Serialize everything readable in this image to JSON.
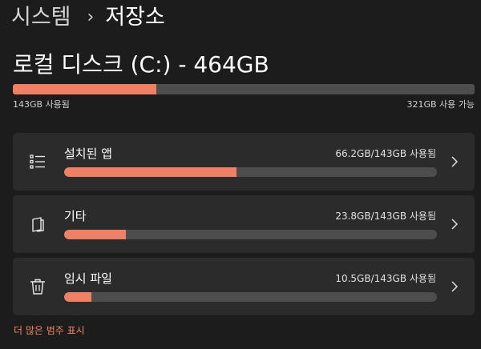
{
  "breadcrumb": {
    "parent": "시스템",
    "separator": "›",
    "current": "저장소"
  },
  "drive": {
    "title": "로컬 디스크 (C:) - 464GB",
    "used_label": "143GB 사용됨",
    "free_label": "321GB 사용 가능",
    "used_fraction": 0.31
  },
  "categories": [
    {
      "label": "설치된 앱",
      "usage": "66.2GB/143GB 사용됨",
      "fraction": 0.463,
      "icon": "apps-list-icon"
    },
    {
      "label": "기타",
      "usage": "23.8GB/143GB 사용됨",
      "fraction": 0.166,
      "icon": "other-document-icon"
    },
    {
      "label": "임시 파일",
      "usage": "10.5GB/143GB 사용됨",
      "fraction": 0.073,
      "icon": "trash-icon"
    }
  ],
  "more_link": "더 많은 범주 표시",
  "colors": {
    "accent": "#ee8066",
    "background": "#1c1c1c",
    "card": "#2b2b2b",
    "bar_track": "#4d4d4d",
    "link": "#f28463"
  }
}
